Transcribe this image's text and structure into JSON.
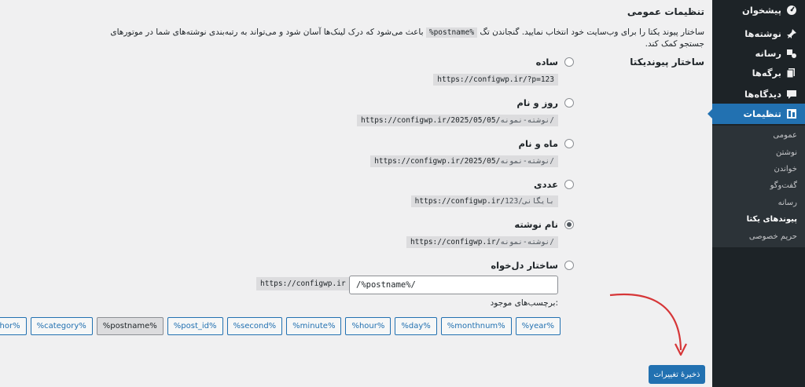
{
  "sidebar": {
    "items": [
      {
        "label": "پیشخوان",
        "icon": "dashboard-icon"
      },
      {
        "label": "نوشته‌ها",
        "icon": "pin-icon"
      },
      {
        "label": "رسانه",
        "icon": "media-icon"
      },
      {
        "label": "برگه‌ها",
        "icon": "pages-icon"
      },
      {
        "label": "دیدگاه‌ها",
        "icon": "comment-icon"
      },
      {
        "label": "تنظیمات",
        "icon": "settings-icon"
      }
    ],
    "submenu": [
      {
        "label": "عمومی"
      },
      {
        "label": "نوشتن"
      },
      {
        "label": "خواندن"
      },
      {
        "label": "گفت‌وگو"
      },
      {
        "label": "رسانه"
      },
      {
        "label": "پیوندهای یکتا"
      },
      {
        "label": "حریم خصوصی"
      }
    ]
  },
  "page": {
    "title": "تنظیمات عمومی",
    "intro_before": "ساختار پیوند یکتا را برای وب‌سایت خود انتخاب نمایید. گنجاندن تگ",
    "intro_code": "%postname%",
    "intro_after": "باعث می‌شود که درک لینک‌ها آسان شود و می‌تواند به رتبه‌بندی نوشته‌های شما در موتورهای جستجو کمک کند."
  },
  "permalink": {
    "section_label": "ساختار پیوندیکتا",
    "options": [
      {
        "label": "ساده",
        "sample": "https://configwp.ir/?p=123",
        "sample_suffix": "",
        "checked": false
      },
      {
        "label": "روز و نام",
        "sample": "https://configwp.ir/2025/05/05/",
        "sample_suffix": "نوشته-نمونه/",
        "checked": false
      },
      {
        "label": "ماه و نام",
        "sample": "https://configwp.ir/2025/05/",
        "sample_suffix": "نوشته-نمونه/",
        "checked": false
      },
      {
        "label": "عددی",
        "sample": "https://configwp.ir/",
        "sample_suffix": "بایگانی/123",
        "checked": false
      },
      {
        "label": "نام نوشته",
        "sample": "https://configwp.ir/",
        "sample_suffix": "نوشته-نمونه/",
        "checked": true
      },
      {
        "label": "ساختار دل‌خواه",
        "sample": "",
        "sample_suffix": "",
        "checked": false
      }
    ],
    "custom_base": "https://configwp.ir",
    "custom_value": "/%postname%/",
    "tags_label": "برچسب‌های موجود:",
    "tags": [
      "%year%",
      "%monthnum%",
      "%day%",
      "%hour%",
      "%minute%",
      "%second%",
      "%post_id%",
      "%postname%",
      "%category%",
      "%author%"
    ],
    "active_tag": "%postname%"
  },
  "actions": {
    "save_label": "ذخیرهٔ تغییرات"
  },
  "colors": {
    "accent": "#2271b1",
    "sidebar_bg": "#1d2327",
    "arrow": "#d63638"
  }
}
